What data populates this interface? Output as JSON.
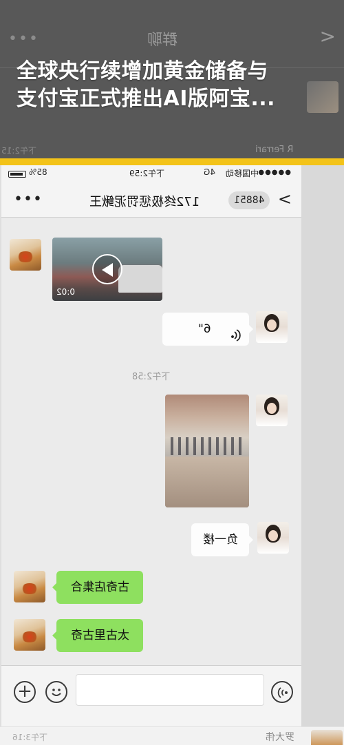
{
  "banner": {
    "headline_line1": "全球央行续增加黄金储备与",
    "headline_line2": "支付宝正式推出AI版阿宝...",
    "background_title": "群聊",
    "background_name": "R Ferrari",
    "background_time": "下午2:15",
    "accent_color": "#f3c319"
  },
  "status_bar": {
    "battery_pct": "85%",
    "time": "下午2:59",
    "network": "4G",
    "carrier": "中国移动"
  },
  "chat": {
    "title": "172终极惩罚泥鳅王",
    "member_count": "48851",
    "timestamp": "下午2:58",
    "video_duration": "0:02",
    "voice_duration": "6\"",
    "message_floor": "负一楼",
    "message_gather": "古奇店集合",
    "message_inside": "太古里古奇",
    "accent_green": "#8ee05f"
  },
  "bottom_preview": {
    "name": "罗大伟",
    "time": "下午3:16"
  },
  "icons": [
    "more-icon",
    "back-chevron-icon",
    "play-icon",
    "voice-wave-icon",
    "plus-icon",
    "emoji-icon",
    "voice-input-icon"
  ]
}
